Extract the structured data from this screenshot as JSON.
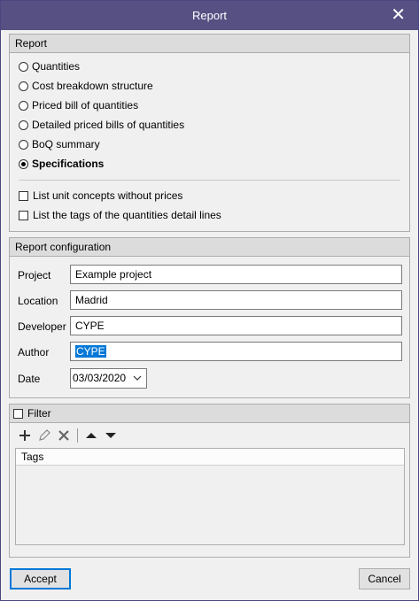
{
  "window": {
    "title": "Report"
  },
  "report": {
    "header": "Report",
    "options": [
      {
        "label": "Quantities",
        "selected": false
      },
      {
        "label": "Cost breakdown structure",
        "selected": false
      },
      {
        "label": "Priced bill of quantities",
        "selected": false
      },
      {
        "label": "Detailed priced bills of quantities",
        "selected": false
      },
      {
        "label": "BoQ summary",
        "selected": false
      },
      {
        "label": "Specifications",
        "selected": true
      }
    ],
    "checks": [
      {
        "label": "List unit concepts without prices",
        "checked": false
      },
      {
        "label": "List the tags of the quantities detail lines",
        "checked": false
      }
    ]
  },
  "config": {
    "header": "Report configuration",
    "project": {
      "label": "Project",
      "value": "Example project"
    },
    "location": {
      "label": "Location",
      "value": "Madrid"
    },
    "developer": {
      "label": "Developer",
      "value": "CYPE"
    },
    "author": {
      "label": "Author",
      "value": "CYPE"
    },
    "date": {
      "label": "Date",
      "value": "03/03/2020"
    }
  },
  "filter": {
    "label": "Filter",
    "checked": false,
    "toolbar": [
      "add-icon",
      "edit-pencil-icon",
      "delete-x-icon",
      "move-up-icon",
      "move-down-icon"
    ],
    "columns": [
      "Tags"
    ]
  },
  "buttons": {
    "accept": "Accept",
    "cancel": "Cancel"
  }
}
